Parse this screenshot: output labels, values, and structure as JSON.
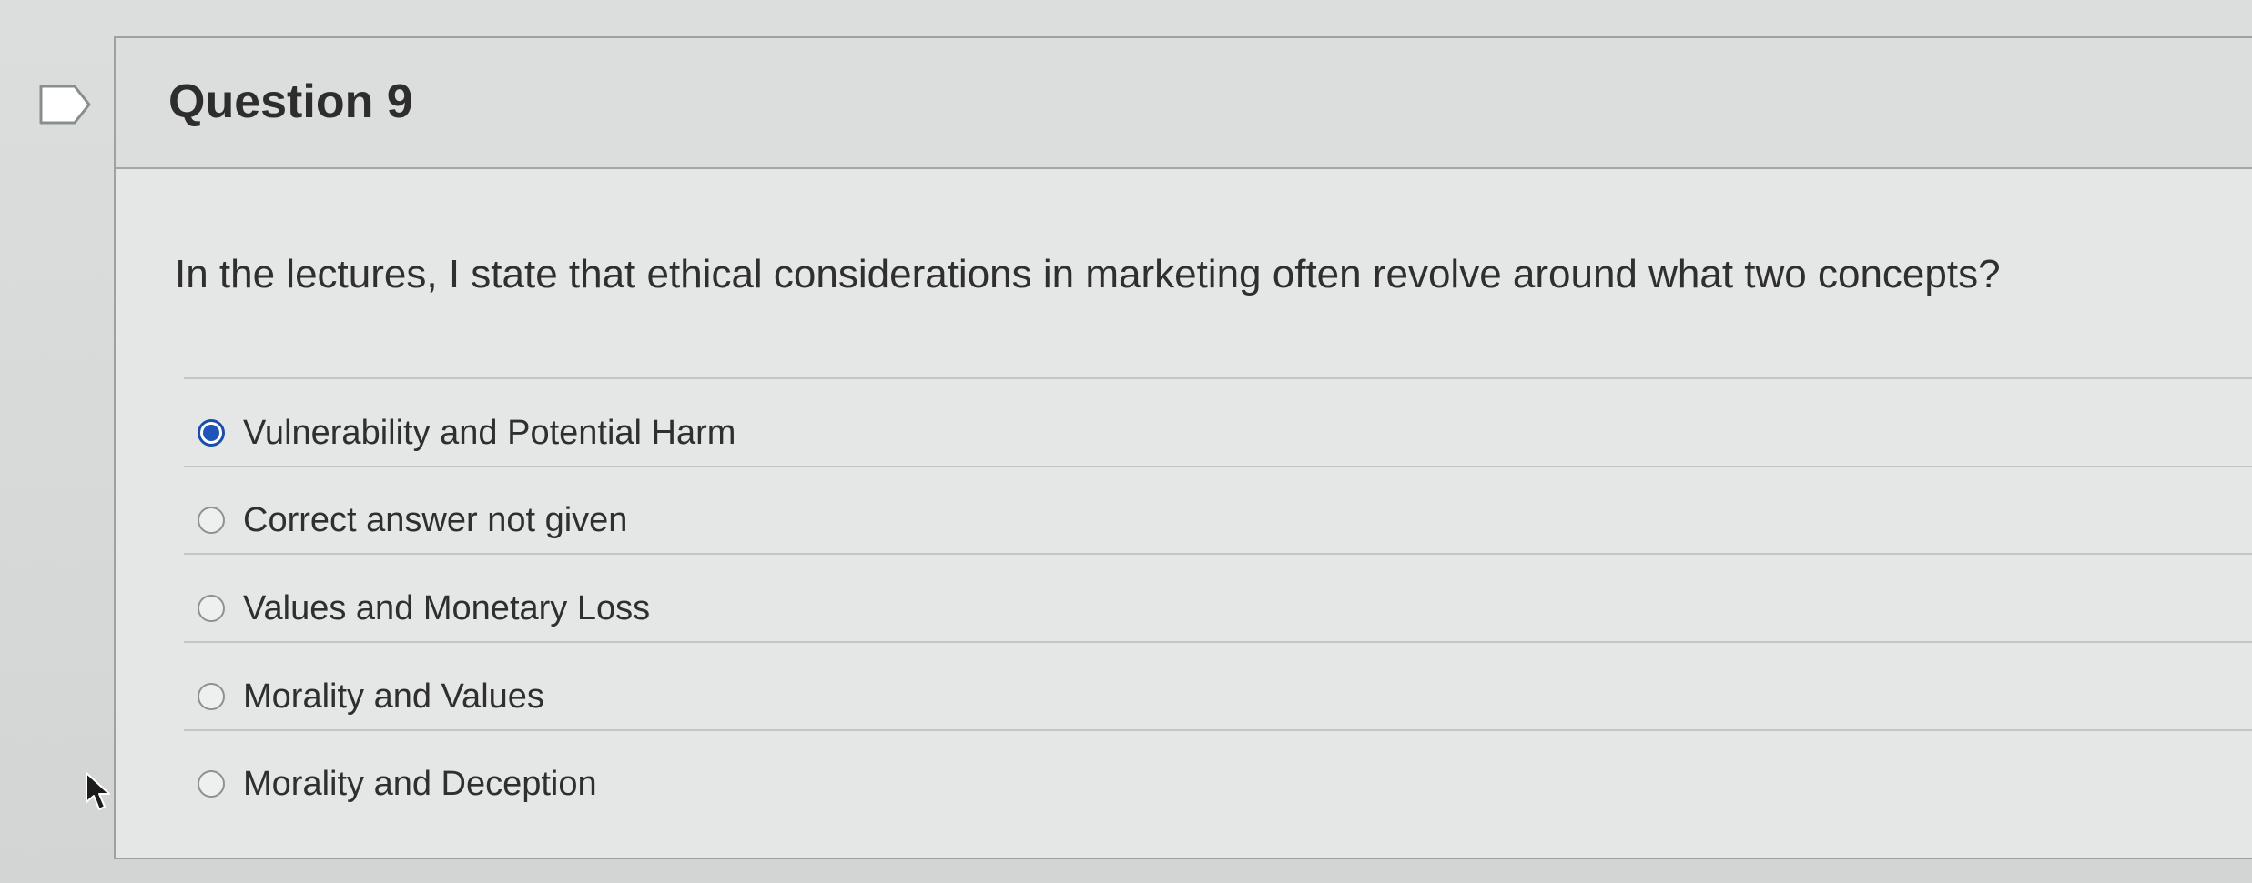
{
  "question": {
    "title": "Question 9",
    "text": "In the lectures, I state that ethical considerations in marketing often revolve around what two concepts?",
    "options": [
      {
        "label": "Vulnerability and Potential Harm",
        "selected": true
      },
      {
        "label": "Correct answer not given",
        "selected": false
      },
      {
        "label": "Values and Monetary Loss",
        "selected": false
      },
      {
        "label": "Morality and Values",
        "selected": false
      },
      {
        "label": "Morality and Deception",
        "selected": false
      }
    ]
  },
  "colors": {
    "selected_radio": "#1f55b8",
    "background": "#dcdede"
  },
  "icons": {
    "flag": "flag-icon",
    "cursor": "mouse-pointer-icon"
  }
}
